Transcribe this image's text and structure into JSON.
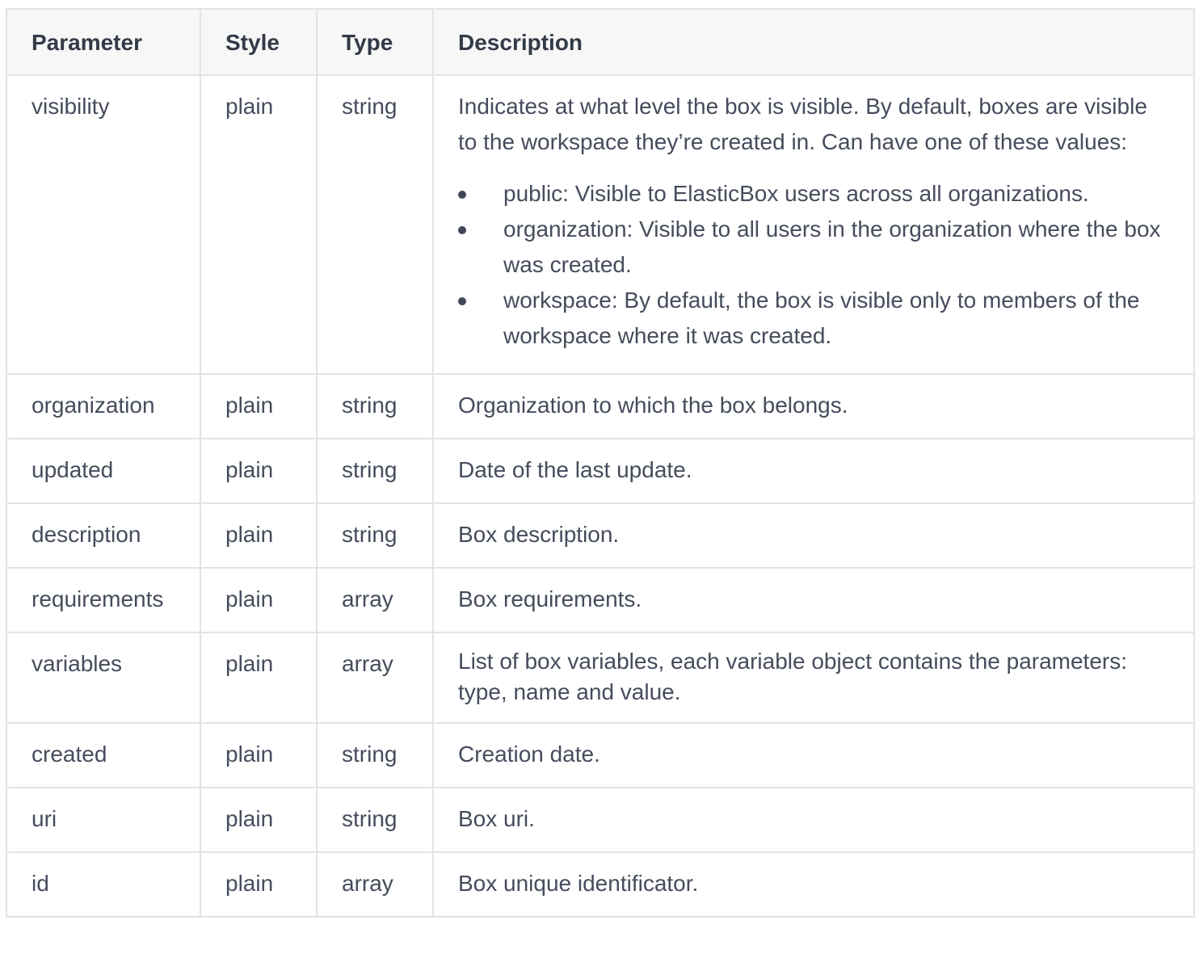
{
  "table": {
    "headers": [
      "Parameter",
      "Style",
      "Type",
      "Description"
    ],
    "visibility_row": {
      "parameter": "visibility",
      "style": "plain",
      "type": "string",
      "description": "Indicates at what level the box is visible. By default, boxes are visible to the workspace they’re created in. Can have one of these values:",
      "values": [
        "public: Visible to ElasticBox users across all organizations.",
        "organization: Visible to all users in the organization where the box was created.",
        "workspace: By default, the box is visible only to members of the workspace where it was created."
      ]
    },
    "rows": [
      {
        "parameter": "organization",
        "style": "plain",
        "type": "string",
        "description": "Organization to which the box belongs."
      },
      {
        "parameter": "updated",
        "style": "plain",
        "type": "string",
        "description": "Date of the last update."
      },
      {
        "parameter": "description",
        "style": "plain",
        "type": "string",
        "description": "Box description."
      },
      {
        "parameter": "requirements",
        "style": "plain",
        "type": "array",
        "description": "Box requirements."
      },
      {
        "parameter": "variables",
        "style": "plain",
        "type": "array",
        "description": "List of box variables, each variable object contains the parameters: type, name and value."
      },
      {
        "parameter": "created",
        "style": "plain",
        "type": "string",
        "description": "Creation date."
      },
      {
        "parameter": "uri",
        "style": "plain",
        "type": "string",
        "description": "Box uri."
      },
      {
        "parameter": "id",
        "style": "plain",
        "type": "array",
        "description": "Box unique identificator."
      }
    ]
  }
}
